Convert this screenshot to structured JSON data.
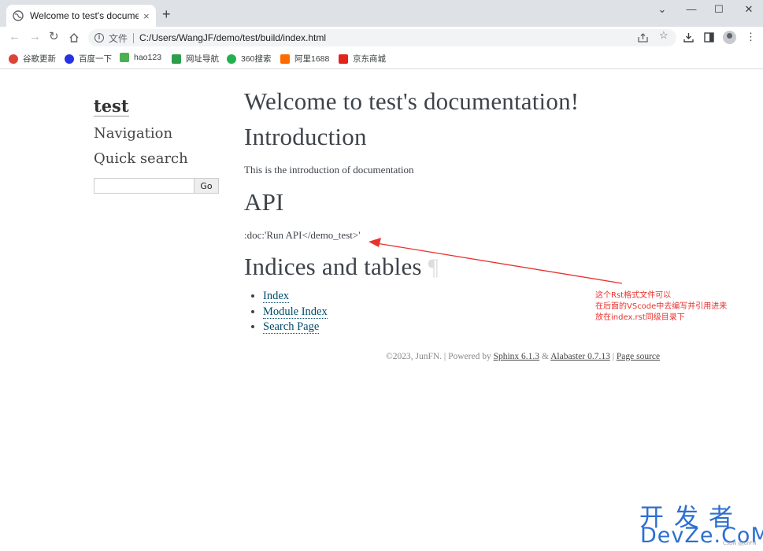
{
  "browser": {
    "tab_title": "Welcome to test's documentation",
    "tab_close": "×",
    "new_tab": "+",
    "window_controls": {
      "minimize": "—",
      "maximize": "☐",
      "close": "✕",
      "chevron": "⌄"
    },
    "scheme_label": "文件",
    "url": "C:/Users/WangJF/demo/test/build/index.html"
  },
  "bookmarks": [
    {
      "label": "谷歌更新",
      "color": "#db4437"
    },
    {
      "label": "百度一下",
      "color": "#2932e1"
    },
    {
      "label": "hao123",
      "color": "#4caf50"
    },
    {
      "label": "网址导航",
      "color": "#2e9e4b"
    },
    {
      "label": "360搜索",
      "color": "#22b14c"
    },
    {
      "label": "阿里1688",
      "color": "#ff6a00"
    },
    {
      "label": "京东商城",
      "color": "#e1251b"
    }
  ],
  "sidebar": {
    "title": "test",
    "navigation": "Navigation",
    "quick_search": "Quick search",
    "go_label": "Go"
  },
  "main": {
    "title": "Welcome to test's documentation!",
    "intro_heading": "Introduction",
    "intro_text": "This is the introduction of documentation",
    "api_heading": "API",
    "api_text": ":doc:'Run API</demo_test>'",
    "indices_heading": "Indices and tables",
    "pilcrow": "¶",
    "links": [
      "Index",
      "Module Index",
      "Search Page"
    ]
  },
  "footer": {
    "copyright": "©2023, JunFN. | Powered by ",
    "sphinx": "Sphinx 6.1.3",
    "amp": " & ",
    "alabaster": "Alabaster 0.7.13",
    "pipe": " | ",
    "page_source": "Page source"
  },
  "annotation": {
    "line1": "这个Rst格式文件可以",
    "line2": "在后面的VScode中去编写并引用进来",
    "line3": "放在index.rst同级目录下",
    "color": "#e8322d"
  },
  "watermark": {
    "top": "开发者",
    "bottom": "DevZe.CoM",
    "csdn": "CSDN @JunFN"
  }
}
